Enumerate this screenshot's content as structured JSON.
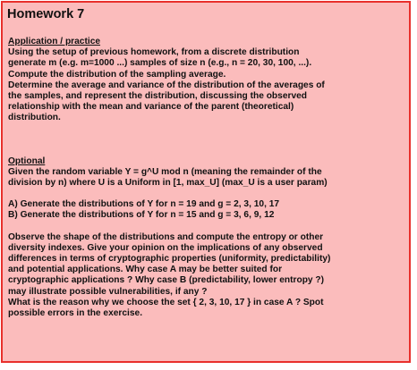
{
  "title": "Homework 7",
  "application": {
    "heading": "Application / practice",
    "lines": [
      "Using the setup of previous homework, from a discrete distribution",
      "generate m (e.g. m=1000 ...) samples of size n (e.g., n = 20, 30, 100, ...).",
      "Compute the distribution of the sampling average.",
      "Determine the average and variance of the distribution of the averages of",
      "the samples, and represent the distribution, discussing the observed",
      "relationship with the mean and variance of the parent (theoretical)",
      "distribution."
    ]
  },
  "optional": {
    "heading": "Optional",
    "intro_lines": [
      "Given the random variable Y = g^U mod n (meaning the remainder of the",
      "division by n) where U is a Uniform in [1, max_U] (max_U is a user param)"
    ],
    "cases": [
      "A) Generate the distributions of Y for n = 19 and g = 2, 3, 10, 17",
      "B) Generate the distributions of Y for n = 15 and g = 3, 6, 9, 12"
    ],
    "discussion_lines": [
      "Observe the shape of the distributions and compute the entropy or other",
      "diversity indexes. Give your opinion on the implications of any observed",
      "differences in terms of cryptographic properties (uniformity, predictability)",
      "and potential applications. Why case A may be better suited for",
      "cryptographic applications ? Why case B (predictability, lower entropy ?)",
      "may illustrate possible vulnerabilities, if any ?",
      "What is the reason why we choose the set { 2, 3, 10, 17 } in case A ? Spot",
      "possible errors in the exercise."
    ]
  }
}
